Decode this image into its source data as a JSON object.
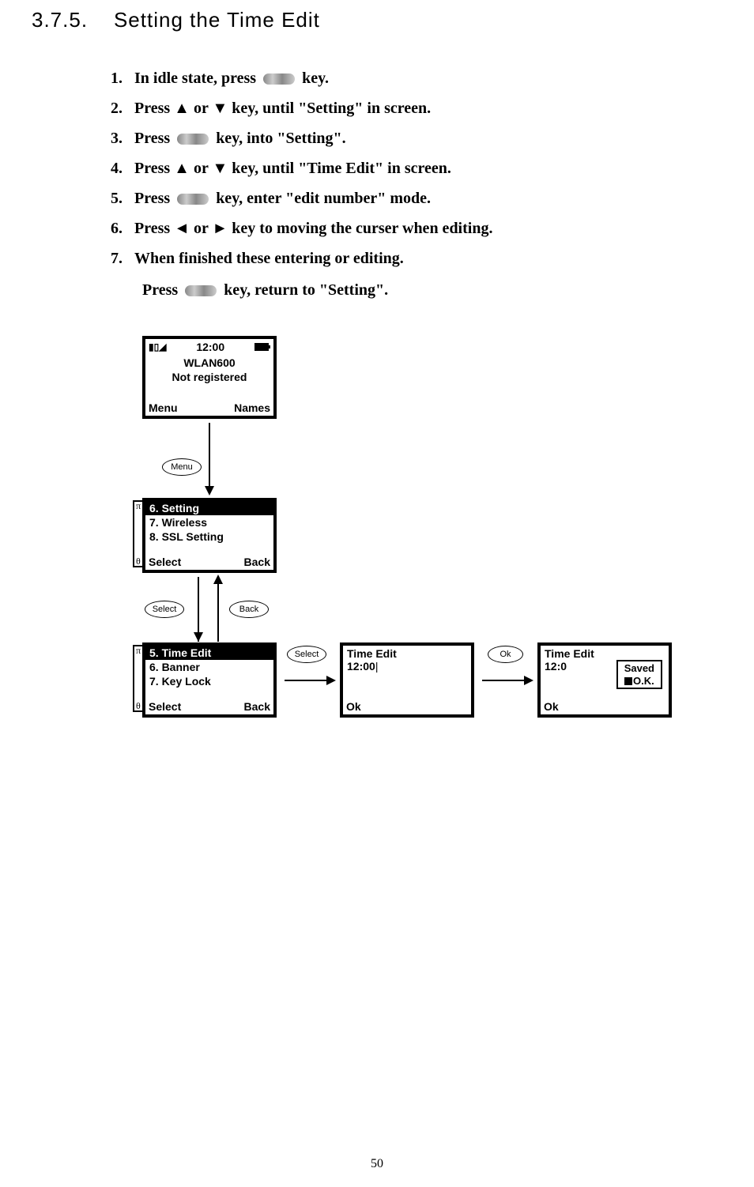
{
  "section_number": "3.7.5.",
  "section_title": "Setting the Time Edit",
  "instructions": [
    {
      "n": "1.",
      "before": "In idle state, press",
      "key": true,
      "after": "key."
    },
    {
      "n": "2.",
      "before": "Press ▲ or ▼ key, until \"Setting\" in screen.",
      "key": false,
      "after": ""
    },
    {
      "n": "3.",
      "before": "Press",
      "key": true,
      "after": " key, into \"Setting\"."
    },
    {
      "n": "4.",
      "before": "Press ▲ or ▼ key, until \"Time Edit\" in screen.",
      "key": false,
      "after": ""
    },
    {
      "n": "5.",
      "before": "Press",
      "key": true,
      "after": " key, enter \"edit number\" mode."
    },
    {
      "n": "6.",
      "before": "Press ◄ or ► key to moving the curser when editing.",
      "key": false,
      "after": ""
    },
    {
      "n": "7.",
      "before": "When finished these entering or editing.",
      "key": false,
      "after": ""
    }
  ],
  "final_press_before": "Press",
  "final_press_after": " key, return to \"Setting\".",
  "idle": {
    "time": "12:00",
    "name": "WLAN600",
    "status": "Not registered",
    "left": "Menu",
    "right": "Names"
  },
  "menu_screen": {
    "rows": [
      "6. Setting",
      "7. Wireless",
      "8. SSL Setting"
    ],
    "left": "Select",
    "right": "Back"
  },
  "setting_screen": {
    "rows": [
      "5. Time Edit",
      "6. Banner",
      "7. Key Lock"
    ],
    "left": "Select",
    "right": "Back"
  },
  "edit_screen": {
    "title": "Time Edit",
    "value": "12:00",
    "cursor": "|",
    "left": "Ok"
  },
  "saved_screen": {
    "title": "Time Edit",
    "value": "12:0",
    "overlay1": "Saved",
    "overlay2": "O.K.",
    "left": "Ok"
  },
  "buttons": {
    "menu": "Menu",
    "select": "Select",
    "back": "Back",
    "ok": "Ok"
  },
  "greek": {
    "pi": "π",
    "theta": "θ"
  },
  "page_number": "50"
}
